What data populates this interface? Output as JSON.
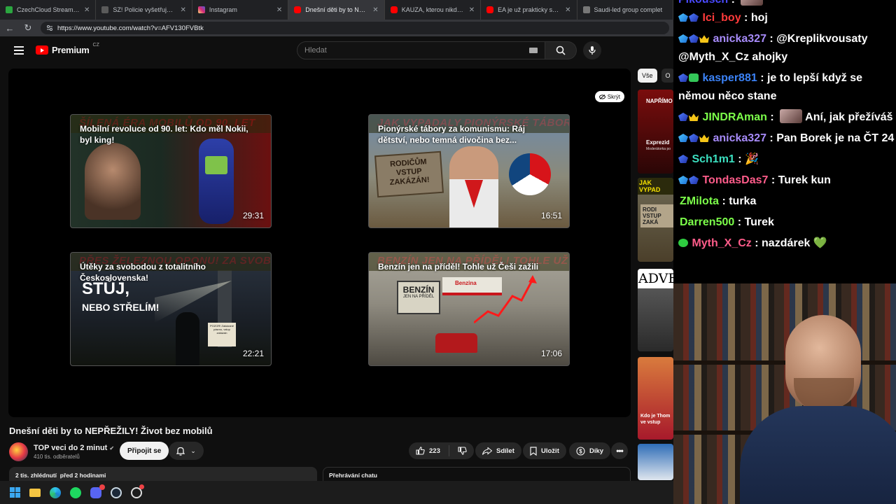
{
  "browser": {
    "tabs": [
      {
        "label": "CzechCloud Stream - Watch",
        "color": "#2ba640",
        "active": false
      },
      {
        "label": "SZ! Policie vyšetřuje Turkovu ne",
        "color": "#5a5a5a",
        "active": false
      },
      {
        "label": "Instagram",
        "color": "#d6249f",
        "active": false
      },
      {
        "label": "Dnešní děti by to NEPŘEŽILY!",
        "color": "#ff0000",
        "active": true
      },
      {
        "label": "KAUZA, kterou nikdo NECHÁ",
        "color": "#ff0000",
        "active": false
      },
      {
        "label": "EA je už prakticky saúdská. E",
        "color": "#ff0000",
        "active": false
      },
      {
        "label": "Saudi-led group complet",
        "color": "#777777",
        "active": false
      }
    ],
    "url": "https://www.youtube.com/watch?v=AFV130FVBtk"
  },
  "youtube": {
    "logo_text": "Premium",
    "region": "CZ",
    "search_placeholder": "Hledat",
    "hide_label": "Skrýt",
    "endcards": [
      {
        "banner": "ŠÍLENÁ ÉRA MOBILŮ OD 90. LET",
        "title": "Mobilní revoluce od 90. let: Kdo měl Nokii, byl king!",
        "duration": "29:31"
      },
      {
        "banner": "JAK VYPADALY PIONÝRSKÉ TÁBORY V ČSSR?",
        "title": "Pionýrské tábory za komunismu: Ráj dětství, nebo temná divočina bez...",
        "duration": "16:51"
      },
      {
        "banner": "PŘES ŽELEZNOU OPONU! ZA SVOBODOU",
        "title": "Útěky za svobodou z totalitního Československa!",
        "duration": "22:21"
      },
      {
        "banner": "BENZÍN JEN NA PŘÍDĚL! TOHLE UŽ ČEŠI ZAŽILI",
        "title": "Benzín jen na příděl! Tohle už Češi zažili",
        "duration": "17:06"
      }
    ],
    "thumb_text": {
      "card1": "",
      "card2_sign": "RODIČŮM VSTUP ZAKÁZÁN!",
      "card3_big": "STŮJ,",
      "card3_big2": "NEBO STŘELÍM!",
      "card3_sign": "POZOR! Zakázané pásmo, vstup zakázán",
      "card4_sign": "BENZÍN",
      "card4_sign2": "JEN NA PŘÍDĚL",
      "card4_station": "Benzina"
    },
    "video_title": "Dnešní děti by to NEPŘEŽILY! Život bez mobilů",
    "channel_name": "TOP veci do 2 minut",
    "subscribers": "410 tis. odběratelů",
    "join_label": "Připojit se",
    "like_count": "223",
    "share_label": "Sdílet",
    "save_label": "Uložit",
    "thanks_label": "Díky",
    "meta": "2 tis. zhlédnutí  před 2 hodinami",
    "chat_replay": "Přehrávání chatu",
    "chips": [
      "Vše",
      "O"
    ],
    "side_texts": [
      "NAPŘÍMO",
      "Exprezid",
      "Moderátorka po",
      "JAK VYPAD",
      "RODI VSTUP ZAKÁ",
      "ADVE",
      "Kdo je Thom ve vstup"
    ]
  },
  "chat": {
    "messages": [
      {
        "user": "Pikousch",
        "color": "#4a4aff",
        "text": ""
      },
      {
        "user": "Ici_boy",
        "color": "#ff3b3b",
        "text": "hoj"
      },
      {
        "user": "anicka327",
        "color": "#a78bfa",
        "text": "@Kreplikvousaty @Myth_X_Cz ahojky"
      },
      {
        "user": "kasper881",
        "color": "#3b82f6",
        "text": "je to lepší když se němou něco stane"
      },
      {
        "user": "JINDRAman",
        "color": "#7cff4a",
        "text": "Aní, jak přežíváš"
      },
      {
        "user": "anicka327",
        "color": "#a78bfa",
        "text": "Pan Borek je na ČT 24"
      },
      {
        "user": "Sch1m1",
        "color": "#3be0c0",
        "text": "🎉"
      },
      {
        "user": "TondasDas7",
        "color": "#ff5c8a",
        "text": "Turek kun"
      },
      {
        "user": "ZMilota",
        "color": "#7cff4a",
        "text": "turka"
      },
      {
        "user": "Darren500",
        "color": "#7cff4a",
        "text": "Turek"
      },
      {
        "user": "Myth_X_Cz",
        "color": "#ff5c8a",
        "text": "nazdárek 💚"
      }
    ]
  }
}
